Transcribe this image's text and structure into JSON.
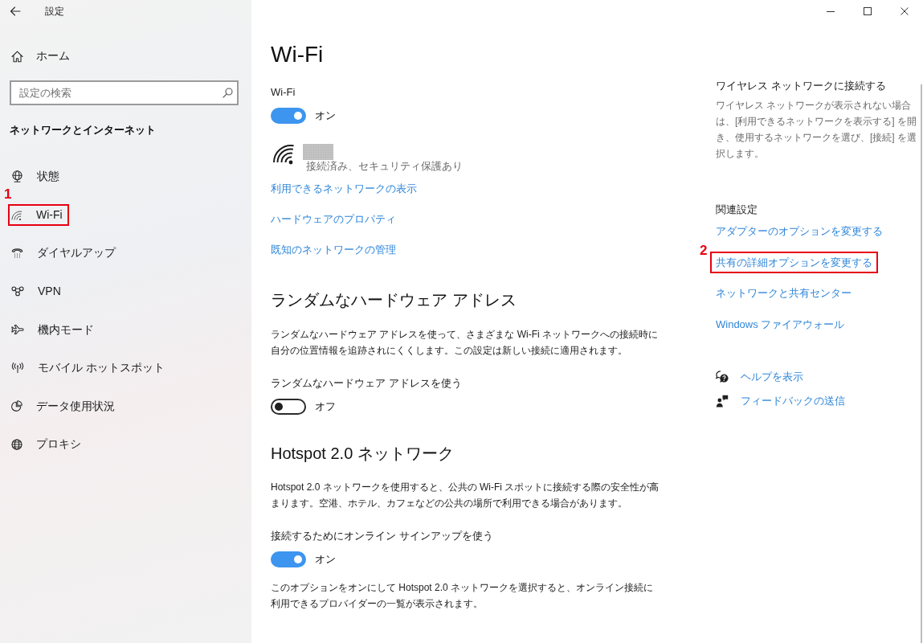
{
  "window": {
    "title": "設定"
  },
  "sidebar": {
    "home": "ホーム",
    "search": {
      "placeholder": "設定の検索"
    },
    "section_title": "ネットワークとインターネット",
    "items": [
      {
        "label": "状態",
        "highlighted": false
      },
      {
        "label": "Wi-Fi",
        "highlighted": true,
        "callout": "1"
      },
      {
        "label": "ダイヤルアップ",
        "highlighted": false
      },
      {
        "label": "VPN",
        "highlighted": false
      },
      {
        "label": "機内モード",
        "highlighted": false
      },
      {
        "label": "モバイル ホットスポット",
        "highlighted": false
      },
      {
        "label": "データ使用状況",
        "highlighted": false
      },
      {
        "label": "プロキシ",
        "highlighted": false
      }
    ]
  },
  "main": {
    "title": "Wi-Fi",
    "wifi_switch": {
      "label": "Wi-Fi",
      "on": true,
      "state_text": "オン"
    },
    "connection": {
      "status": "接続済み、セキュリティ保護あり"
    },
    "links": [
      "利用できるネットワークの表示",
      "ハードウェアのプロパティ",
      "既知のネットワークの管理"
    ],
    "sections": [
      {
        "heading": "ランダムなハードウェア アドレス",
        "description": "ランダムなハードウェア アドレスを使って、さまざまな Wi-Fi ネットワークへの接続時に自分の位置情報を追跡されにくくします。この設定は新しい接続に適用されます。",
        "setting": {
          "label": "ランダムなハードウェア アドレスを使う",
          "on": false,
          "state_text": "オフ"
        }
      },
      {
        "heading": "Hotspot 2.0 ネットワーク",
        "description": "Hotspot 2.0 ネットワークを使用すると、公共の Wi-Fi スポットに接続する際の安全性が高まります。空港、ホテル、カフェなどの公共の場所で利用できる場合があります。",
        "setting": {
          "label": "接続するためにオンライン サインアップを使う",
          "on": true,
          "state_text": "オン"
        },
        "note": "このオプションをオンにして Hotspot 2.0 ネットワークを選択すると、オンライン接続に利用できるプロバイダーの一覧が表示されます。"
      }
    ]
  },
  "side_panel": {
    "connect_heading": "ワイヤレス ネットワークに接続する",
    "connect_text": "ワイヤレス ネットワークが表示されない場合は、[利用できるネットワークを表示する] を開き、使用するネットワークを選び、[接続] を選択します。",
    "related_heading": "関連設定",
    "related_links": [
      {
        "label": "アダプターのオプションを変更する",
        "highlighted": false
      },
      {
        "label": "共有の詳細オプションを変更する",
        "highlighted": true,
        "callout": "2"
      },
      {
        "label": "ネットワークと共有センター",
        "highlighted": false
      },
      {
        "label": "Windows ファイアウォール",
        "highlighted": false
      }
    ],
    "help_links": [
      {
        "label": "ヘルプを表示"
      },
      {
        "label": "フィードバックの送信"
      }
    ]
  }
}
